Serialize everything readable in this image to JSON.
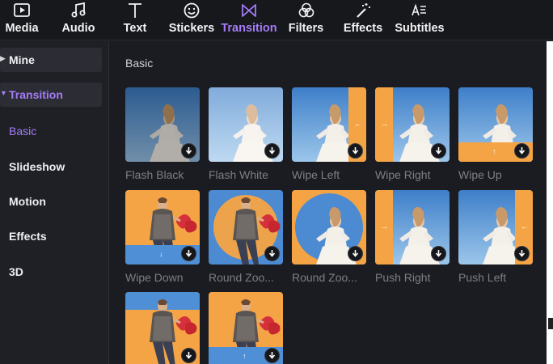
{
  "toolbar": {
    "tabs": [
      {
        "label": "Media",
        "icon": "media-icon"
      },
      {
        "label": "Audio",
        "icon": "music-note-icon"
      },
      {
        "label": "Text",
        "icon": "text-t-icon"
      },
      {
        "label": "Stickers",
        "icon": "smiley-icon"
      },
      {
        "label": "Transition",
        "icon": "bowtie-transition-icon",
        "active": true
      },
      {
        "label": "Filters",
        "icon": "filters-circles-icon"
      },
      {
        "label": "Effects",
        "icon": "magic-wand-icon"
      },
      {
        "label": "Subtitles",
        "icon": "subtitles-ae-icon"
      }
    ]
  },
  "sidebar": {
    "mine": "Mine",
    "transition": "Transition",
    "subs": [
      "Basic",
      "Slideshow",
      "Motion",
      "Effects",
      "3D"
    ]
  },
  "content": {
    "section_title": "Basic",
    "items": [
      {
        "name": "Flash Black"
      },
      {
        "name": "Flash White"
      },
      {
        "name": "Wipe Left"
      },
      {
        "name": "Wipe Right"
      },
      {
        "name": "Wipe Up"
      },
      {
        "name": "Wipe Down"
      },
      {
        "name": "Round Zoo..."
      },
      {
        "name": "Round Zoo..."
      },
      {
        "name": "Push Right"
      },
      {
        "name": "Push Left"
      },
      {
        "name": ""
      },
      {
        "name": ""
      }
    ]
  },
  "colors": {
    "accent": "#a47cf7",
    "orange": "#f5a445",
    "sky": "#4f8fd6"
  }
}
